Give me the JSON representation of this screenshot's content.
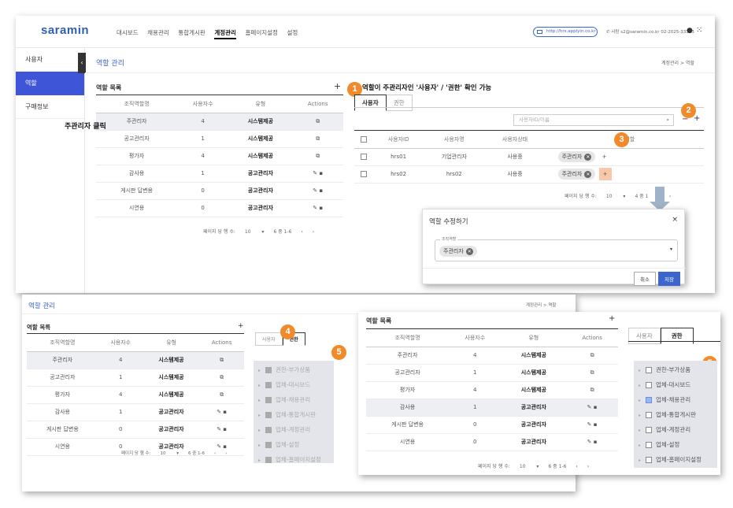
{
  "brand": "saramin",
  "nav": [
    "대시보드",
    "채용관리",
    "통합게시판",
    "계정관리",
    "홈페이지설정",
    "설정"
  ],
  "url": "http://hrs.applyin.co.kr",
  "user": "사람 s2@saramin.co.kr 02-2025-33333",
  "sidebar": [
    "사용자",
    "역할",
    "구매정보"
  ],
  "page_title": "역할 관리",
  "breadcrumb": "계정관리 > 역할",
  "list_title": "역할 목록",
  "cols": [
    "조직역할명",
    "사용자수",
    "유형",
    "Actions"
  ],
  "roles": [
    {
      "name": "주관리자",
      "count": "4",
      "type": "시스템제공"
    },
    {
      "name": "공고관리자",
      "count": "1",
      "type": "시스템제공"
    },
    {
      "name": "평가자",
      "count": "4",
      "type": "시스템제공"
    },
    {
      "name": "감사용",
      "count": "1",
      "type": "공고관리자"
    },
    {
      "name": "게시판 답변용",
      "count": "0",
      "type": "공고관리자"
    },
    {
      "name": "시연용",
      "count": "0",
      "type": "공고관리자"
    }
  ],
  "pager": {
    "label": "페이지 당 행 수:",
    "size": "10",
    "range": "6 중 1-6",
    "range2": "4 중 1"
  },
  "annot_title": "역할이 주관리자인 '사용자' / '권한' 확인 가능",
  "annot_click": "주관리자 클릭",
  "tabs": [
    "사용자",
    "권한"
  ],
  "search_placeholder": "사용자ID/이름",
  "ucols": [
    "사용자ID",
    "사용자명",
    "사용자상태",
    "조직역할"
  ],
  "users": [
    {
      "id": "hrs01",
      "name": "기업관리자",
      "status": "사용중",
      "role": "주관리자"
    },
    {
      "id": "hrs02",
      "name": "hrs02",
      "status": "사용중",
      "role": "주관리자"
    }
  ],
  "modal": {
    "title": "역할 수정하기",
    "field": "조직역할",
    "chip": "주관리자",
    "cancel": "취소",
    "save": "저장"
  },
  "perms": [
    "권한-부가상품",
    "업체-대시보드",
    "업체-채용관리",
    "업체-통합게시판",
    "업체-계정관리",
    "업체-설정",
    "업체-홈페이지설정"
  ],
  "badges": [
    "1",
    "2",
    "3",
    "4",
    "5",
    "5"
  ]
}
